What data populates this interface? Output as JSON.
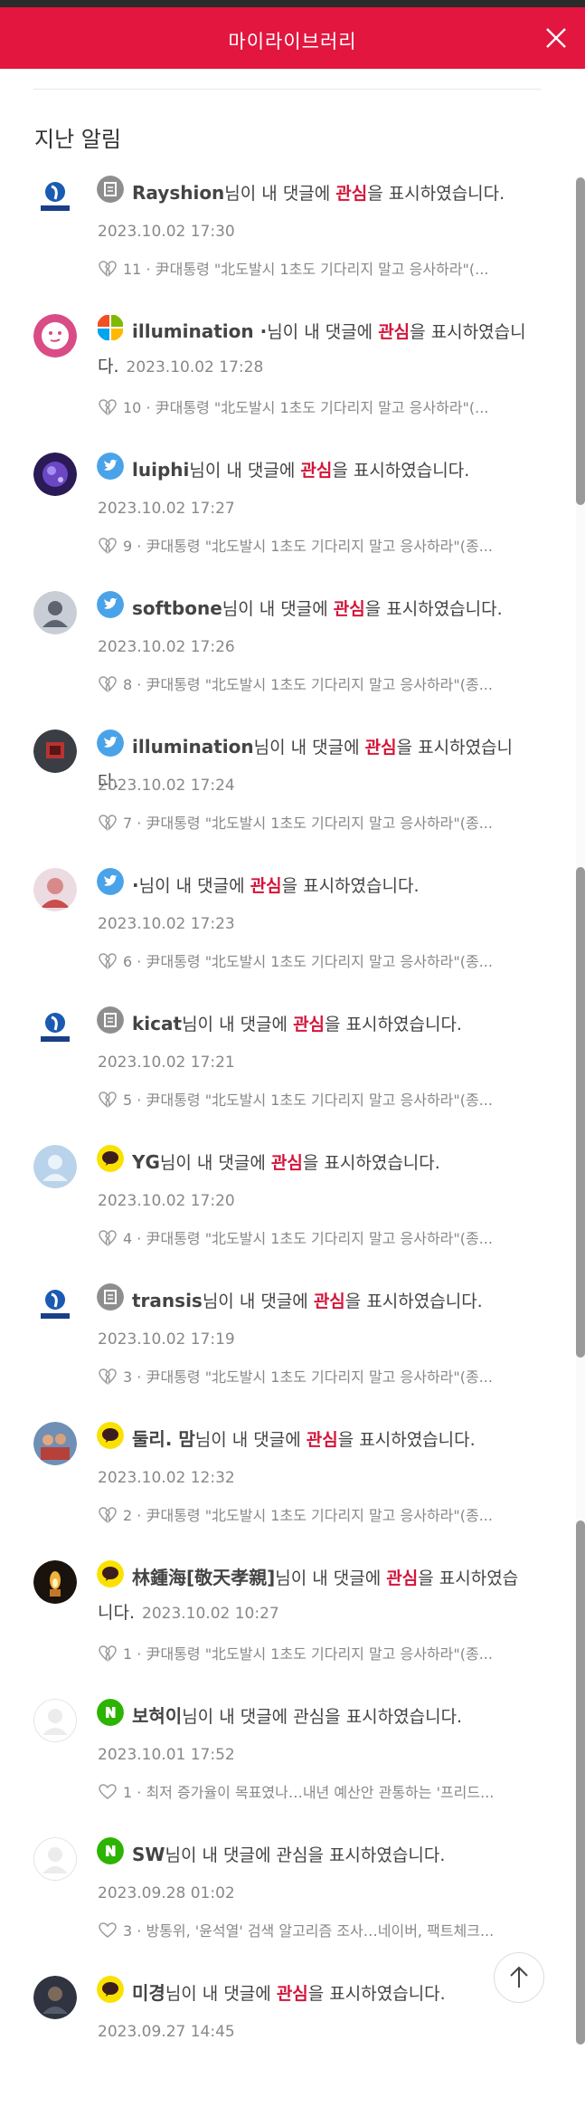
{
  "header": {
    "title": "마이라이브러리",
    "close_icon": "close-icon"
  },
  "section_title": "지난 알림",
  "notifications": [
    {
      "avatar": "yonhap-logo",
      "badge": "yonhap-badge-icon",
      "user": "Rayshion",
      "msg_pre": "님이 내 댓글에 ",
      "keyword": "관심",
      "msg_post": "을 표시하였습니다.",
      "time": "2023.10.02 17:30",
      "heart": "broken-heart-icon",
      "count": "11",
      "article": "尹대통령 \"北도발시 1초도 기다리지 말고 응사하라\"(..."
    },
    {
      "avatar": "pink-face-avatar",
      "badge": "microsoft-badge-icon",
      "user": "illumination ·",
      "msg_pre": "님이 내 댓글에 ",
      "keyword": "관심",
      "msg_post": "을 표시하였습니",
      "msg_wrap": "다.",
      "time": "2023.10.02 17:28",
      "heart": "broken-heart-icon",
      "count": "10",
      "article": "尹대통령 \"北도발시 1초도 기다리지 말고 응사하라\"(..."
    },
    {
      "avatar": "purple-sparkle-avatar",
      "badge": "twitter-badge-icon",
      "user": "luiphi",
      "msg_pre": "님이 내 댓글에 ",
      "keyword": "관심",
      "msg_post": "을 표시하였습니다.",
      "time": "2023.10.02 17:27",
      "heart": "broken-heart-icon",
      "count": "9",
      "article": "尹대통령 \"北도발시 1초도 기다리지 말고 응사하라\"(종..."
    },
    {
      "avatar": "default-user-avatar",
      "badge": "twitter-badge-icon",
      "user": "softbone",
      "msg_pre": "님이 내 댓글에 ",
      "keyword": "관심",
      "msg_post": "을 표시하였습니다.",
      "time": "2023.10.02 17:26",
      "heart": "broken-heart-icon",
      "count": "8",
      "article": "尹대통령 \"北도발시 1초도 기다리지 말고 응사하라\"(종..."
    },
    {
      "avatar": "dark-photo-avatar",
      "badge": "twitter-badge-icon",
      "user": "illumination",
      "msg_pre": "님이 내 댓글에 ",
      "keyword": "관심",
      "msg_post": "을 표시하였습니다.",
      "time": "2023.10.02 17:24",
      "heart": "broken-heart-icon",
      "count": "7",
      "article": "尹대통령 \"北도발시 1초도 기다리지 말고 응사하라\"(종..."
    },
    {
      "avatar": "person-photo-avatar",
      "badge": "twitter-badge-icon",
      "user": "·",
      "msg_pre": "님이 내 댓글에 ",
      "keyword": "관심",
      "msg_post": "을 표시하였습니다.",
      "time": "2023.10.02 17:23",
      "heart": "broken-heart-icon",
      "count": "6",
      "article": "尹대통령 \"北도발시 1초도 기다리지 말고 응사하라\"(종..."
    },
    {
      "avatar": "yonhap-logo",
      "badge": "yonhap-badge-icon",
      "user": "kicat",
      "msg_pre": "님이 내 댓글에 ",
      "keyword": "관심",
      "msg_post": "을 표시하였습니다.",
      "time": "2023.10.02 17:21",
      "heart": "broken-heart-icon",
      "count": "5",
      "article": "尹대통령 \"北도발시 1초도 기다리지 말고 응사하라\"(종..."
    },
    {
      "avatar": "default-light-avatar",
      "badge": "kakao-badge-icon",
      "user": "YG",
      "msg_pre": "님이 내 댓글에 ",
      "keyword": "관심",
      "msg_post": "을 표시하였습니다.",
      "time": "2023.10.02 17:20",
      "heart": "broken-heart-icon",
      "count": "4",
      "article": "尹대통령 \"北도발시 1초도 기다리지 말고 응사하라\"(종..."
    },
    {
      "avatar": "yonhap-logo",
      "badge": "yonhap-badge-icon",
      "user": "transis",
      "msg_pre": "님이 내 댓글에 ",
      "keyword": "관심",
      "msg_post": "을 표시하였습니다.",
      "time": "2023.10.02 17:19",
      "heart": "broken-heart-icon",
      "count": "3",
      "article": "尹대통령 \"北도발시 1초도 기다리지 말고 응사하라\"(종..."
    },
    {
      "avatar": "group-photo-avatar",
      "badge": "kakao-badge-icon",
      "user": "둘리. 맘",
      "msg_pre": "님이 내 댓글에 ",
      "keyword": "관심",
      "msg_post": "을 표시하였습니다.",
      "time": "2023.10.02 12:32",
      "heart": "broken-heart-icon",
      "count": "2",
      "article": "尹대통령 \"北도발시 1초도 기다리지 말고 응사하라\"(종..."
    },
    {
      "avatar": "candle-photo-avatar",
      "badge": "kakao-badge-icon",
      "user": "林鍾海[敬天孝親]",
      "msg_pre": "님이 내 댓글에 ",
      "keyword": "관심",
      "msg_post": "을 표시하였습",
      "msg_wrap": "니다.",
      "time": "2023.10.02 10:27",
      "heart": "broken-heart-icon",
      "count": "1",
      "article": "尹대통령 \"北도발시 1초도 기다리지 말고 응사하라\"(종..."
    },
    {
      "avatar": "blank-avatar",
      "badge": "naver-badge-icon",
      "user": "보혀이",
      "msg_pre": "님이 내 댓글에 ",
      "keyword": "관심",
      "msg_post": "을 표시하였습니다.",
      "time": "2023.10.01 17:52",
      "heart": "heart-outline-icon",
      "count": "1",
      "article": "최저 증가율이 목표였나…내년 예산안 관통하는 '프리드..."
    },
    {
      "avatar": "blank-avatar",
      "badge": "naver-badge-icon",
      "user": "SW",
      "msg_pre": "님이 내 댓글에 ",
      "keyword": "관심",
      "msg_post": "을 표시하였습니다.",
      "time": "2023.09.28 01:02",
      "heart": "heart-outline-icon",
      "count": "3",
      "article": "방통위, '윤석열' 검색 알고리즘 조사…네이버, 팩트체크..."
    },
    {
      "avatar": "dark-person-avatar",
      "badge": "kakao-badge-icon",
      "user": "미경",
      "msg_pre": "님이 내 댓글에 ",
      "keyword": "관심",
      "msg_post": "을 표시하였습니다.",
      "time": "2023.09.27 14:45",
      "heart": "broken-heart-icon",
      "count": "",
      "article": ""
    }
  ],
  "colors": {
    "accent": "#e2163f",
    "keyword": "#d4153a"
  },
  "scroll_to_top_icon": "arrow-up-icon"
}
